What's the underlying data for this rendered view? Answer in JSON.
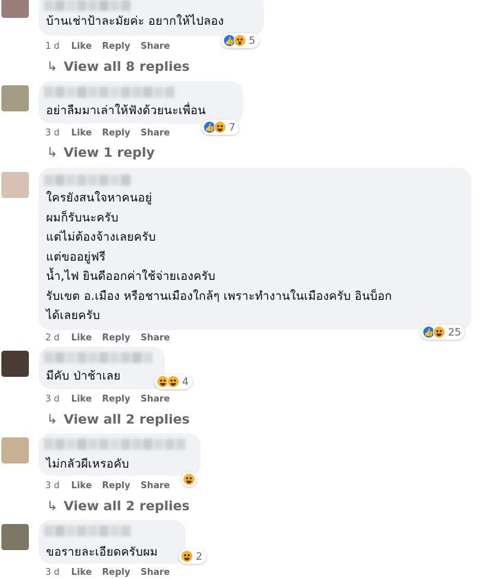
{
  "comments": [
    {
      "lines": [
        "บ้านเช่าป้าละมัยค่ะ อยากให้ไปลอง"
      ],
      "time": "1 d",
      "like": "Like",
      "reply": "Reply",
      "share": "Share",
      "reactions": {
        "icons": [
          "like-icon",
          "wow-icon"
        ],
        "count": "5"
      },
      "view_replies": "View all 8 replies",
      "avatar_color": "#9a7e7a"
    },
    {
      "lines": [
        "อย่าลืมมาเล่าให้ฟังด้วยนะเพื่อน"
      ],
      "time": "3 d",
      "like": "Like",
      "reply": "Reply",
      "share": "Share",
      "reactions": {
        "icons": [
          "like-icon",
          "haha-icon"
        ],
        "count": "7"
      },
      "view_replies": "View 1 reply",
      "avatar_color": "#a49c83"
    },
    {
      "lines": [
        "ใครยังสนใจหาคนอยู่",
        "ผมก็รับนะครับ",
        "แต่ไม่ต้องจ้างเลยครับ",
        "แต่ขออยู่ฟรี",
        "น้ำ,ไฟ ยินดีออกค่าใช้จ่ายเองครับ",
        "รับเขต อ.เมือง หรือชานเมืองใกล้ๆ เพราะทำงานในเมืองครับ อินบ็อก",
        "ได้เลยครับ"
      ],
      "time": "2 d",
      "like": "Like",
      "reply": "Reply",
      "share": "Share",
      "reactions": {
        "icons": [
          "like-icon",
          "haha-icon"
        ],
        "count": "25"
      },
      "avatar_color": "#d8c0b4"
    },
    {
      "lines": [
        "มีคับ ป่าช้าเลย"
      ],
      "time": "3 d",
      "like": "Like",
      "reply": "Reply",
      "share": "Share",
      "reactions": {
        "icons": [
          "haha-icon",
          "love-icon"
        ],
        "count": "4"
      },
      "view_replies": "View all 2 replies",
      "avatar_color": "#4a3c34"
    },
    {
      "lines": [
        "ไม่กลัวผีเหรอคับ"
      ],
      "time": "3 d",
      "like": "Like",
      "reply": "Reply",
      "share": "Share",
      "reactions": {
        "icons": [
          "haha-icon"
        ],
        "count": ""
      },
      "view_replies": "View all 2 replies",
      "avatar_color": "#c8b092"
    },
    {
      "lines": [
        "ขอรายละเอียดครับผม"
      ],
      "time": "3 d",
      "like": "Like",
      "reply": "Reply",
      "share": "Share",
      "reactions": {
        "icons": [
          "haha-icon"
        ],
        "count": "2"
      },
      "avatar_color": "#7d7866"
    }
  ],
  "colors": {
    "bubble": "#f0f2f5",
    "meta": "#65676b",
    "like": "#1877f2",
    "emoji": "#f7b125"
  }
}
